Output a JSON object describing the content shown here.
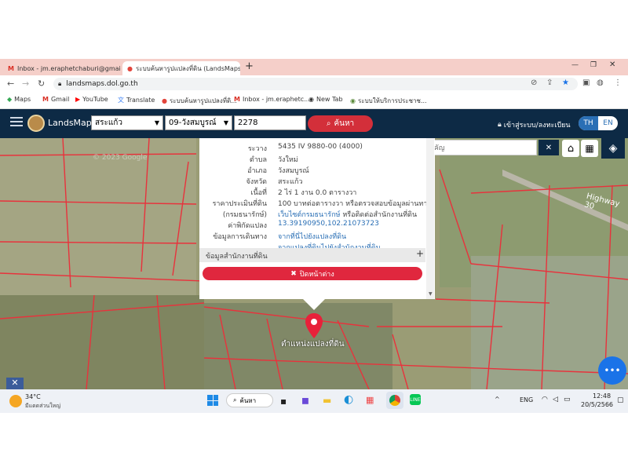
{
  "browser": {
    "tabs": [
      {
        "title": "Inbox - jm.eraphetchaburi@gmai",
        "icon": "gmail-icon"
      },
      {
        "title": "ระบบค้นหารูปแปลงที่ดิน (LandsMaps)",
        "icon": "landsmaps-pin-icon"
      }
    ],
    "new_tab_label": "+",
    "url": "landsmaps.dol.go.th",
    "bookmarks": [
      {
        "label": "Maps",
        "icon": "maps-icon"
      },
      {
        "label": "Gmail",
        "icon": "gmail-icon"
      },
      {
        "label": "YouTube",
        "icon": "youtube-icon"
      },
      {
        "label": "Translate",
        "icon": "translate-icon"
      },
      {
        "label": "ระบบค้นหารูปแปลงที่ดิ...",
        "icon": "pin-icon"
      },
      {
        "label": "Inbox - jm.eraphetc...",
        "icon": "gmail-icon"
      },
      {
        "label": "New Tab",
        "icon": "globe-icon"
      },
      {
        "label": "ระบบให้บริการประชาช...",
        "icon": "globe-icon"
      }
    ]
  },
  "app": {
    "brand": "LandsMaps",
    "province": "สระแก้ว",
    "district": "09-วังสมบูรณ์",
    "parcel_no": "2278",
    "search_label": "ค้นหา",
    "login_label": "เข้าสู่ระบบ/ลงทะเบียน",
    "lang_th": "TH",
    "lang_en": "EN",
    "place_search_placeholder": "ค้นหาสถานที่สำคัญ"
  },
  "popup": {
    "rows": [
      {
        "label": "ระวาง",
        "value": "5435 IV 9880-00 (4000)"
      },
      {
        "label": "ตำบล",
        "value": "วังใหม่"
      },
      {
        "label": "อำเภอ",
        "value": "วังสมบูรณ์"
      },
      {
        "label": "จังหวัด",
        "value": "สระแก้ว"
      },
      {
        "label": "เนื้อที่",
        "value": "2 ไร่ 1 งาน 0.0 ตารางวา"
      },
      {
        "label": "ราคาประเมินที่ดิน",
        "value": "100 บาทต่อตารางวา หรือตรวจสอบข้อมูลผ่านทาง"
      },
      {
        "label": "(กรมธนารักษ์)",
        "value": "เว็บไซต์กรมธนารักษ์",
        "value_suffix": "หรือติดต่อสำนักงานที่ดิน"
      },
      {
        "label": "ค่าพิกัดแปลง",
        "value": "13.39190950,102.21073723"
      },
      {
        "label": "ข้อมูลการเดินทาง",
        "value": "จากที่นี่ไปยังแปลงที่ดิน"
      },
      {
        "label": "",
        "value": "จากแปลงที่ดินไปยังสำนักงานที่ดิน"
      }
    ],
    "section_label": "ข้อมูลสำนักงานที่ดิน",
    "section_toggle": "+",
    "close_label": "ปิดหน้าต่าง"
  },
  "map": {
    "marker_label": "ตำแหน่งแปลงที่ดิน",
    "road_label": "Highway 30",
    "watermark": "© 2023 Google"
  },
  "taskbar": {
    "weather_temp": "34°C",
    "weather_desc": "มีแดดส่วนใหญ่",
    "search_label": "ค้นหา",
    "lang": "ENG",
    "time": "12:48",
    "date": "20/5/2566"
  },
  "colors": {
    "header_bg": "#0d2a45",
    "search_red": "#d32f3a",
    "parcel_line": "#e8323c",
    "link_blue": "#2a6fb5"
  }
}
